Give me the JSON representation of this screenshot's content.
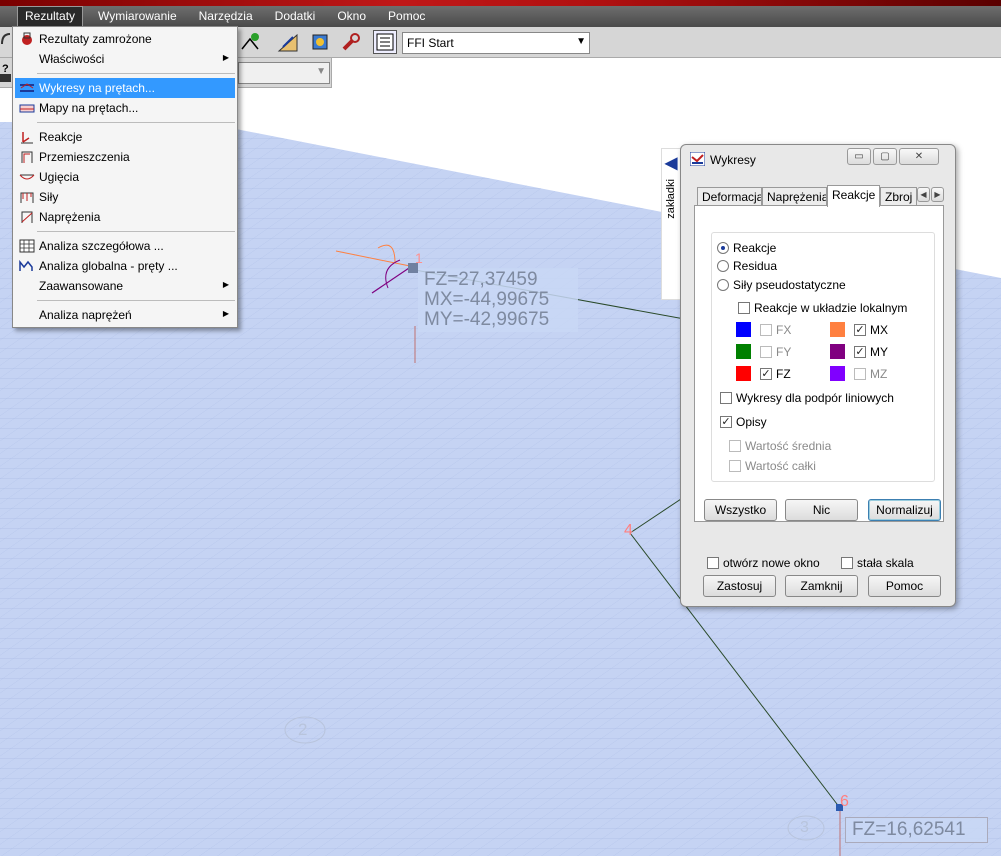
{
  "menubar": {
    "items": [
      "Rezultaty",
      "Wymiarowanie",
      "Narzędzia",
      "Dodatki",
      "Okno",
      "Pomoc"
    ]
  },
  "toolbar": {
    "combo_value": "FFI Start"
  },
  "dropdown": {
    "items": [
      {
        "label": "Rezultaty zamrożone",
        "icon": "frozen-results-icon"
      },
      {
        "label": "Właściwości",
        "icon": "",
        "submenu": true
      },
      {
        "label": "Wykresy na prętach...",
        "icon": "bar-diagrams-icon",
        "highlighted": true
      },
      {
        "label": "Mapy na prętach...",
        "icon": "bar-maps-icon"
      },
      {
        "label": "Reakcje",
        "icon": "reactions-icon"
      },
      {
        "label": "Przemieszczenia",
        "icon": "displacements-icon"
      },
      {
        "label": "Ugięcia",
        "icon": "deflections-icon"
      },
      {
        "label": "Siły",
        "icon": "forces-icon"
      },
      {
        "label": "Naprężenia",
        "icon": "stresses-icon"
      },
      {
        "label": "Analiza szczegółowa ...",
        "icon": "detailed-analysis-icon"
      },
      {
        "label": "Analiza globalna - pręty ...",
        "icon": "global-analysis-icon"
      },
      {
        "label": "Zaawansowane",
        "icon": "",
        "submenu": true
      },
      {
        "label": "Analiza naprężeń",
        "icon": "",
        "submenu": true
      }
    ]
  },
  "viewport": {
    "label1": [
      "FZ=27,37459",
      "MX=-44,99675",
      "MY=-42,99675"
    ],
    "label2": "FZ=16,62541",
    "node_1": "1",
    "node_4": "4",
    "node_6": "6",
    "bar_2": "2",
    "bar_3": "3"
  },
  "side_tab": {
    "label": "zakładki"
  },
  "dialog": {
    "title": "Wykresy",
    "tabs": [
      "Deformacja",
      "Naprężenia",
      "Reakcje",
      "Zbroj"
    ],
    "selected_tab": "Reakcje",
    "radios": [
      "Reakcje",
      "Residua",
      "Siły pseudostatyczne"
    ],
    "local_reactions": "Reakcje w układzie lokalnym",
    "components": [
      {
        "label": "FX",
        "color": "#0000ff",
        "checked": false
      },
      {
        "label": "FY",
        "color": "#008000",
        "checked": false
      },
      {
        "label": "FZ",
        "color": "#ff0000",
        "checked": true
      },
      {
        "label": "MX",
        "color": "#ff8040",
        "checked": true
      },
      {
        "label": "MY",
        "color": "#800080",
        "checked": true
      },
      {
        "label": "MZ",
        "color": "#8000ff",
        "checked": false
      }
    ],
    "line_supports": "Wykresy dla podpór liniowych",
    "descriptions": "Opisy",
    "avg_value": "Wartość średnia",
    "integral_value": "Wartość całki",
    "btn_all": "Wszystko",
    "btn_none": "Nic",
    "btn_normalize": "Normalizuj",
    "new_window": "otwórz nowe okno",
    "const_scale": "stała  skala",
    "btn_apply": "Zastosuj",
    "btn_close": "Zamknij",
    "btn_help": "Pomoc"
  }
}
